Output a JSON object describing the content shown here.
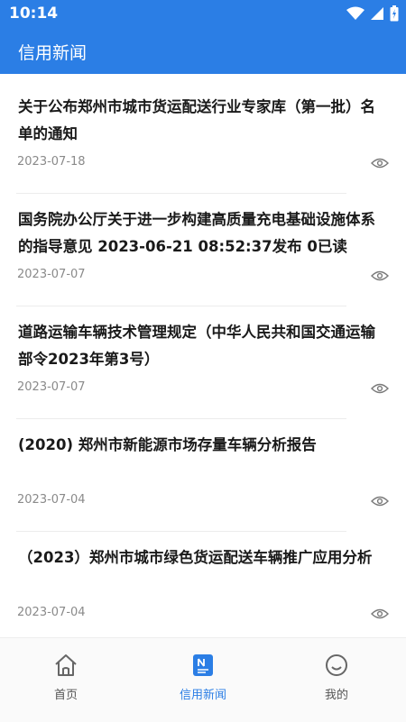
{
  "status": {
    "time": "10:14"
  },
  "app": {
    "title": "信用新闻"
  },
  "news": [
    {
      "title": "关于公布郑州市城市货运配送行业专家库（第一批）名单的通知",
      "date": "2023-07-18"
    },
    {
      "title": "国务院办公厅关于进一步构建高质量充电基础设施体系的指导意见 2023-06-21 08:52:37发布 0已读",
      "date": "2023-07-07"
    },
    {
      "title": "道路运输车辆技术管理规定（中华人民共和国交通运输部令2023年第3号）",
      "date": "2023-07-07"
    },
    {
      "title": "(2020) 郑州市新能源市场存量车辆分析报告",
      "date": "2023-07-04"
    },
    {
      "title": "（2023）郑州市城市绿色货运配送车辆推广应用分析",
      "date": "2023-07-04"
    }
  ],
  "tabs": [
    {
      "label": "首页",
      "icon": "home-icon"
    },
    {
      "label": "信用新闻",
      "icon": "news-icon",
      "active": true
    },
    {
      "label": "我的",
      "icon": "smile-icon"
    }
  ],
  "colors": {
    "primary": "#2b7ee5",
    "title_text": "#1a1a1a",
    "date_text": "#8a8a8a"
  }
}
